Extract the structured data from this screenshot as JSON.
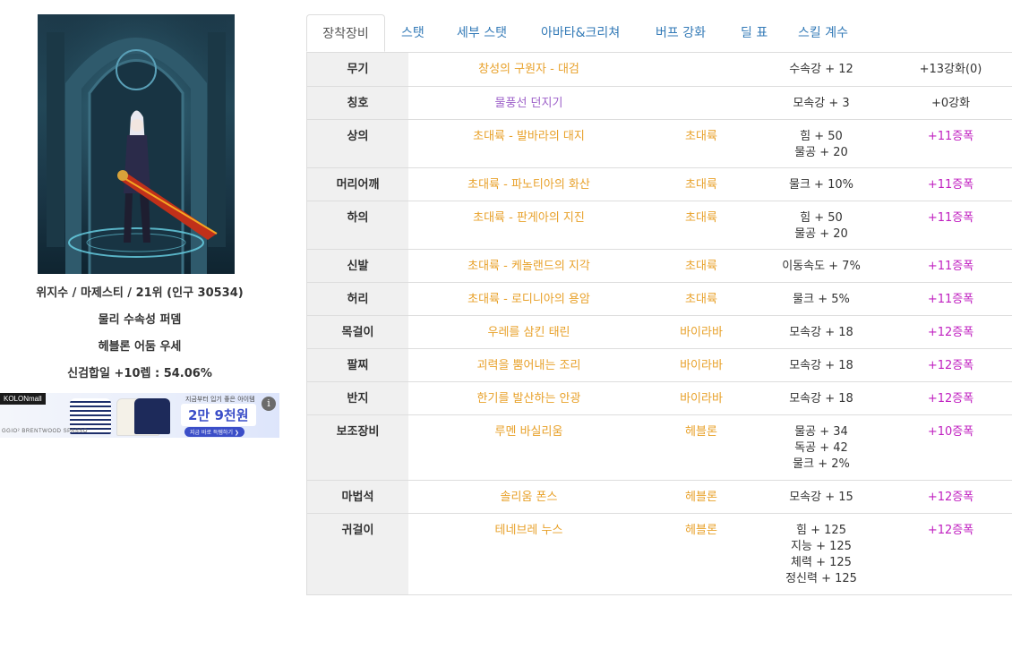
{
  "character": {
    "server_rank": "위지수 / 마제스티 / 21위 (인구 30534)",
    "build": "물리 수속성 퍼뎀",
    "set_name": "헤블론 어둠 우세",
    "weapon_refine": "신검합일 +10렙 : 54.06%"
  },
  "ad": {
    "brand": "KOLONmall",
    "sub": "GGIO² BRENTWOOD SPASSO",
    "copy": "지금부터 입기 좋은 아이템",
    "price": "2만 9천원",
    "cta": "지금 바로 득템하기 ❯",
    "info": "i"
  },
  "tabs": [
    "장착장비",
    "스탯",
    "세부 스탯",
    "아바타&크리쳐",
    "버프 강화",
    "딜 표",
    "스킬 계수"
  ],
  "equipment": [
    {
      "slot": "무기",
      "name": "창성의 구원자 - 대검",
      "set": "",
      "stats": [
        "수속강 + 12"
      ],
      "upgrade": "+13강화(0)",
      "amp": false,
      "purple": false
    },
    {
      "slot": "칭호",
      "name": "물풍선 던지기",
      "set": "",
      "stats": [
        "모속강 + 3"
      ],
      "upgrade": "+0강화",
      "amp": false,
      "purple": true
    },
    {
      "slot": "상의",
      "name": "초대륙 - 발바라의 대지",
      "set": "초대륙",
      "stats": [
        "힘 + 50",
        "물공 + 20"
      ],
      "upgrade": "+11증폭",
      "amp": true,
      "purple": false
    },
    {
      "slot": "머리어깨",
      "name": "초대륙 - 파노티아의 화산",
      "set": "초대륙",
      "stats": [
        "물크 + 10%"
      ],
      "upgrade": "+11증폭",
      "amp": true,
      "purple": false
    },
    {
      "slot": "하의",
      "name": "초대륙 - 판게아의 지진",
      "set": "초대륙",
      "stats": [
        "힘 + 50",
        "물공 + 20"
      ],
      "upgrade": "+11증폭",
      "amp": true,
      "purple": false
    },
    {
      "slot": "신발",
      "name": "초대륙 - 케놀랜드의 지각",
      "set": "초대륙",
      "stats": [
        "이동속도 + 7%"
      ],
      "upgrade": "+11증폭",
      "amp": true,
      "purple": false
    },
    {
      "slot": "허리",
      "name": "초대륙 - 로디니아의 용암",
      "set": "초대륙",
      "stats": [
        "물크 + 5%"
      ],
      "upgrade": "+11증폭",
      "amp": true,
      "purple": false
    },
    {
      "slot": "목걸이",
      "name": "우레를 삼킨 태린",
      "set": "바이라바",
      "stats": [
        "모속강 + 18"
      ],
      "upgrade": "+12증폭",
      "amp": true,
      "purple": false
    },
    {
      "slot": "팔찌",
      "name": "괴력을 뿜어내는 조리",
      "set": "바이라바",
      "stats": [
        "모속강 + 18"
      ],
      "upgrade": "+12증폭",
      "amp": true,
      "purple": false
    },
    {
      "slot": "반지",
      "name": "한기를 발산하는 안광",
      "set": "바이라바",
      "stats": [
        "모속강 + 18"
      ],
      "upgrade": "+12증폭",
      "amp": true,
      "purple": false
    },
    {
      "slot": "보조장비",
      "name": "루멘 바실리움",
      "set": "헤블론",
      "stats": [
        "물공 + 34",
        "독공 + 42",
        "물크 + 2%"
      ],
      "upgrade": "+10증폭",
      "amp": true,
      "purple": false
    },
    {
      "slot": "마법석",
      "name": "솔리움 폰스",
      "set": "헤블론",
      "stats": [
        "모속강 + 15"
      ],
      "upgrade": "+12증폭",
      "amp": true,
      "purple": false
    },
    {
      "slot": "귀걸이",
      "name": "테네브레 누스",
      "set": "헤블론",
      "stats": [
        "힘 + 125",
        "지능 + 125",
        "체력 + 125",
        "정신력 + 125"
      ],
      "upgrade": "+12증폭",
      "amp": true,
      "purple": false
    }
  ],
  "colors": {
    "item_name": "#e8a12a",
    "title_name": "#9d60c9",
    "amplify": "#c020c0",
    "tab_link": "#337ab7"
  }
}
